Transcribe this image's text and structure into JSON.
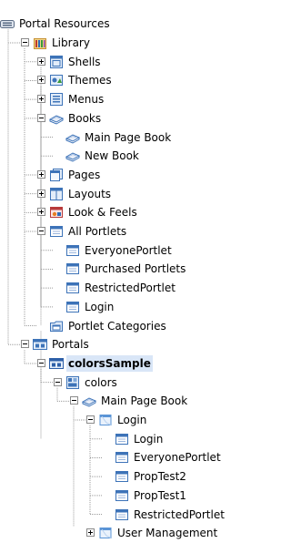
{
  "tree": {
    "nodes": [
      {
        "label": "Portal Resources",
        "icon": "portal-resources-icon",
        "name": "tree-node-portal-resources",
        "expander": "none"
      },
      {
        "label": "Library",
        "icon": "library-icon",
        "name": "tree-node-library",
        "expander": "expanded"
      },
      {
        "label": "Shells",
        "icon": "shells-icon",
        "name": "tree-node-shells",
        "expander": "collapsed"
      },
      {
        "label": "Themes",
        "icon": "themes-icon",
        "name": "tree-node-themes",
        "expander": "collapsed"
      },
      {
        "label": "Menus",
        "icon": "menus-icon",
        "name": "tree-node-menus",
        "expander": "collapsed"
      },
      {
        "label": "Books",
        "icon": "books-icon",
        "name": "tree-node-books",
        "expander": "expanded"
      },
      {
        "label": "Main Page Book",
        "icon": "book-icon",
        "name": "tree-node-main-page-book",
        "expander": "none"
      },
      {
        "label": "New Book",
        "icon": "book-icon",
        "name": "tree-node-new-book",
        "expander": "none"
      },
      {
        "label": "Pages",
        "icon": "pages-icon",
        "name": "tree-node-pages",
        "expander": "collapsed"
      },
      {
        "label": "Layouts",
        "icon": "layouts-icon",
        "name": "tree-node-layouts",
        "expander": "collapsed"
      },
      {
        "label": "Look & Feels",
        "icon": "look-and-feels-icon",
        "name": "tree-node-look-and-feels",
        "expander": "collapsed"
      },
      {
        "label": "All Portlets",
        "icon": "portlets-icon",
        "name": "tree-node-all-portlets",
        "expander": "expanded"
      },
      {
        "label": "EveryonePortlet",
        "icon": "portlet-icon",
        "name": "tree-node-everyone-portlet",
        "expander": "none"
      },
      {
        "label": "Purchased Portlets",
        "icon": "portlet-icon",
        "name": "tree-node-purchased-portlets",
        "expander": "none"
      },
      {
        "label": "RestrictedPortlet",
        "icon": "portlet-icon",
        "name": "tree-node-restricted-portlet",
        "expander": "none"
      },
      {
        "label": "Login",
        "icon": "portlet-icon",
        "name": "tree-node-login-portlet",
        "expander": "none"
      },
      {
        "label": "Portlet Categories",
        "icon": "portlet-categories-icon",
        "name": "tree-node-portlet-categories",
        "expander": "none"
      },
      {
        "label": "Portals",
        "icon": "portals-icon",
        "name": "tree-node-portals",
        "expander": "expanded"
      },
      {
        "label": "colorsSample",
        "icon": "portal-icon",
        "name": "tree-node-colors-sample",
        "expander": "expanded",
        "selected": true
      },
      {
        "label": "colors",
        "icon": "desktop-icon",
        "name": "tree-node-colors",
        "expander": "expanded"
      },
      {
        "label": "Main Page Book",
        "icon": "book-icon",
        "name": "tree-node-desktop-main-page-book",
        "expander": "expanded"
      },
      {
        "label": "Login",
        "icon": "page-icon",
        "name": "tree-node-login-page",
        "expander": "expanded"
      },
      {
        "label": "Login",
        "icon": "portlet-icon",
        "name": "tree-node-login-page-login",
        "expander": "none"
      },
      {
        "label": "EveryonePortlet",
        "icon": "portlet-icon",
        "name": "tree-node-login-page-everyone-portlet",
        "expander": "none"
      },
      {
        "label": "PropTest2",
        "icon": "portlet-icon",
        "name": "tree-node-proptest2",
        "expander": "none"
      },
      {
        "label": "PropTest1",
        "icon": "portlet-icon",
        "name": "tree-node-proptest1",
        "expander": "none"
      },
      {
        "label": "RestrictedPortlet",
        "icon": "portlet-icon",
        "name": "tree-node-login-page-restricted-portlet",
        "expander": "none"
      },
      {
        "label": "User Management",
        "icon": "page-icon",
        "name": "tree-node-user-management",
        "expander": "collapsed"
      }
    ]
  }
}
